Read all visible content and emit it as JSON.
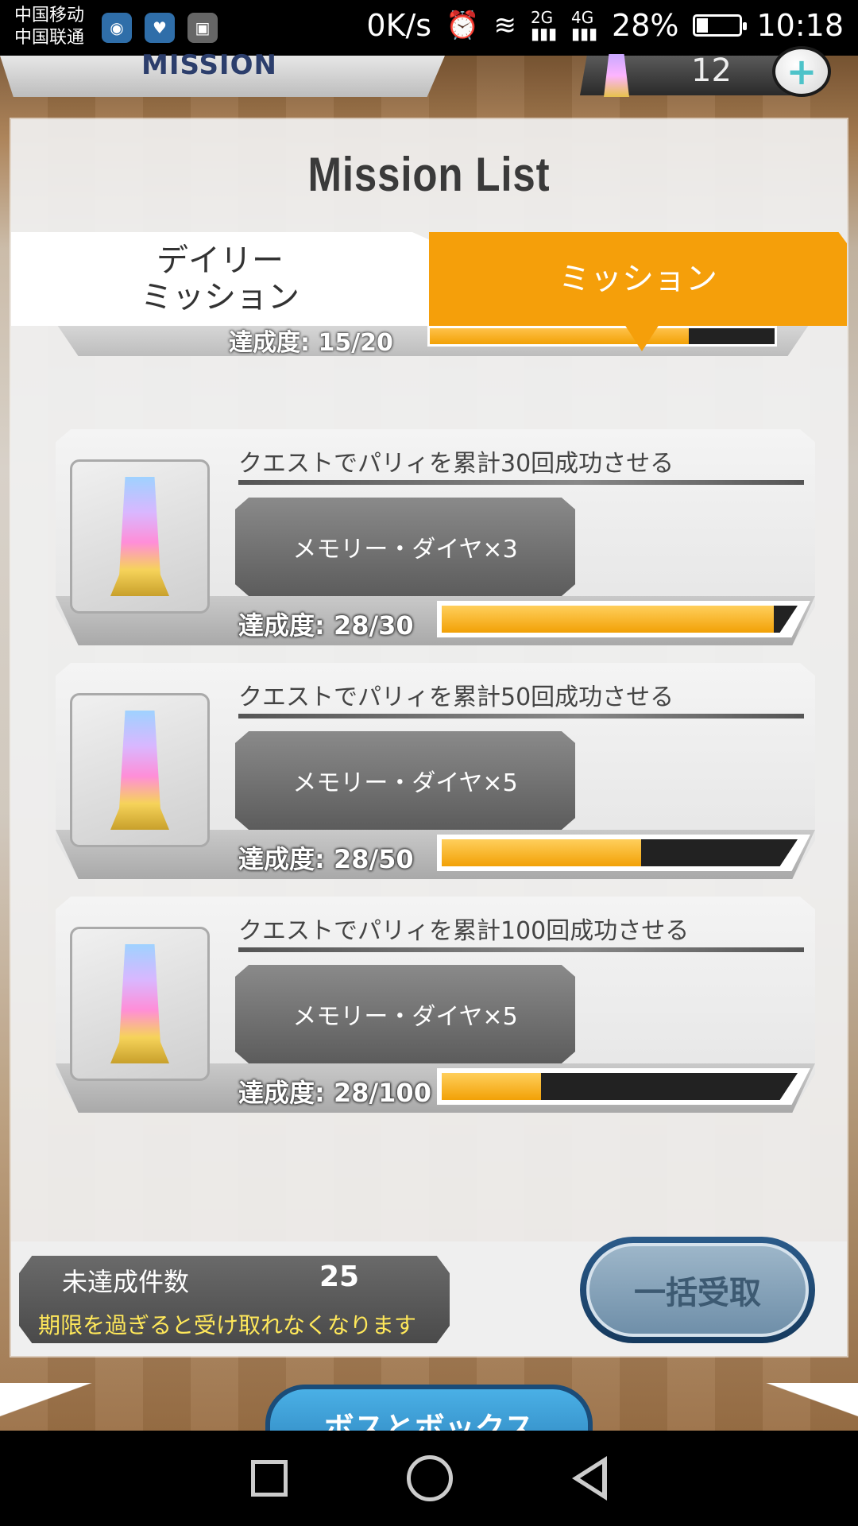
{
  "status_bar": {
    "carrier_1": "中国移动",
    "carrier_2": "中国联通",
    "net_speed": "0K/s",
    "signal_1": "2G",
    "signal_2": "4G",
    "battery": "28%",
    "time": "10:18"
  },
  "header": {
    "banner_text": "MISSION",
    "gem_count": "12",
    "plus_label": "+"
  },
  "panel": {
    "title": "Mission List",
    "tabs": [
      {
        "label": "デイリー\nミッション",
        "active": false
      },
      {
        "label": "ミッション",
        "active": true
      }
    ]
  },
  "partial_mission": {
    "progress_label": "達成度: 15/20",
    "progress": 0.75
  },
  "missions": [
    {
      "title": "クエストでパリィを累計30回成功させる",
      "reward": "メモリー・ダイヤ×3",
      "progress_label": "達成度: 28/30",
      "progress": 0.933
    },
    {
      "title": "クエストでパリィを累計50回成功させる",
      "reward": "メモリー・ダイヤ×5",
      "progress_label": "達成度: 28/50",
      "progress": 0.56
    },
    {
      "title": "クエストでパリィを累計100回成功させる",
      "reward": "メモリー・ダイヤ×5",
      "progress_label": "達成度: 28/100",
      "progress": 0.28
    }
  ],
  "footer": {
    "uncompleted_label": "未達成件数",
    "uncompleted_count": "25",
    "note": "期限を過ぎると受け取れなくなります",
    "claim_all_label": "一括受取",
    "back_label": "ボスとボックス"
  },
  "colors": {
    "accent": "#f59f0a",
    "progress_fill": "#f2a106",
    "note_text": "#ffe85a"
  }
}
